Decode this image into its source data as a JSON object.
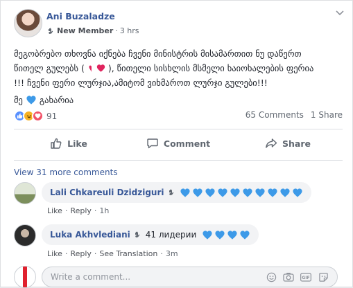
{
  "post": {
    "author": "Ani Buzaladze",
    "badge": "New Member",
    "time": "3 hrs",
    "text_line1": "მეგობრებო თხოვნა იქნება ჩვენი მინისტრის მისამართით ნუ დაწერთ",
    "text_line2a": "წითელ გულებს (",
    "text_line2b": "), წითელი სისხლის მსმელი ხაიოხალების ფერია",
    "text_line3": "!!! ჩვენი ფერი ლურჯია,ამიტომ ვიხმაროთ ლურჯი გულები!!!",
    "text_line4a": "მე",
    "text_line4b": "გახარია"
  },
  "reactions": {
    "count": "91"
  },
  "stats": {
    "comments": "65 Comments",
    "shares": "1 Share"
  },
  "actions": {
    "like": "Like",
    "comment": "Comment",
    "share": "Share"
  },
  "view_more": "View 31 more comments",
  "comments": [
    {
      "name": "Lali Chkareuli Dzidziguri",
      "text": "",
      "like": "Like",
      "reply": "Reply",
      "time": "1h"
    },
    {
      "name": "Luka Akhvlediani",
      "text": "41 лидерии",
      "like": "Like",
      "reply": "Reply",
      "translation": "See Translation",
      "time": "3m"
    }
  ],
  "write": {
    "placeholder": "Write a comment..."
  },
  "colors": {
    "link": "#385898",
    "blue_heart": "#3d9ae8",
    "red_heart": "#e0245e"
  }
}
